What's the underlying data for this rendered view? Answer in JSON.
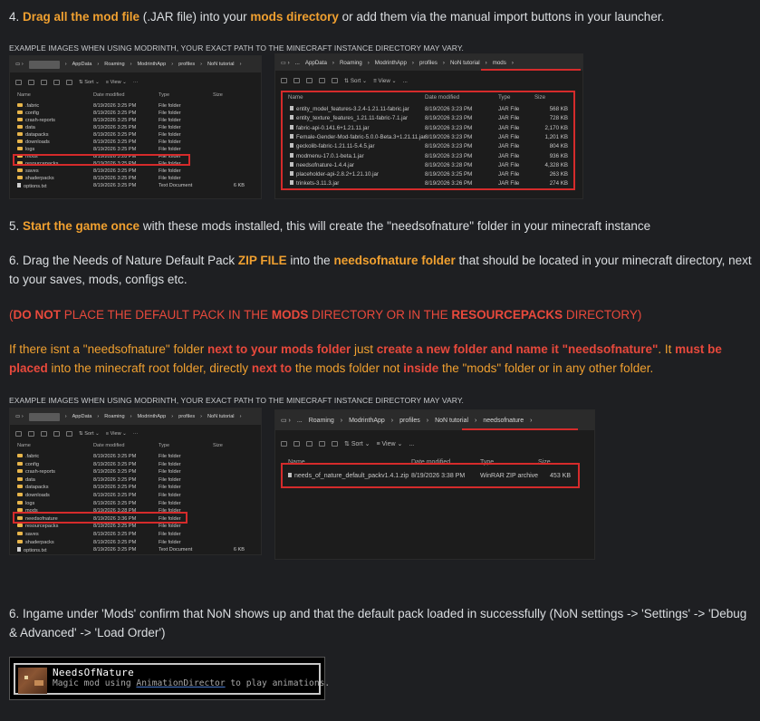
{
  "step4": {
    "prefix": "4. ",
    "b1": "Drag all the mod file",
    "t1": " (.JAR file) into your ",
    "b2": "mods directory",
    "t2": " or add them via the manual import buttons in your launcher."
  },
  "caption": "EXAMPLE IMAGES WHEN USING MODRINTH, YOUR EXACT PATH TO THE MINECRAFT INSTANCE DIRECTORY MAY VARY.",
  "ex1": {
    "path": [
      "AppData",
      "Roaming",
      "ModrinthApp",
      "profiles",
      "NoN tutorial"
    ],
    "tools": [
      "Sort",
      "View"
    ],
    "headers": [
      "Name",
      "Date modified",
      "Type",
      "Size"
    ],
    "rows": [
      {
        "name": ".fabric",
        "date": "8/19/2026 3:25 PM",
        "type": "File folder",
        "size": "",
        "kind": "folder"
      },
      {
        "name": "config",
        "date": "8/19/2026 3:25 PM",
        "type": "File folder",
        "size": "",
        "kind": "folder"
      },
      {
        "name": "crash-reports",
        "date": "8/19/2026 3:25 PM",
        "type": "File folder",
        "size": "",
        "kind": "folder"
      },
      {
        "name": "data",
        "date": "8/19/2026 3:25 PM",
        "type": "File folder",
        "size": "",
        "kind": "folder"
      },
      {
        "name": "datapacks",
        "date": "8/19/2026 3:25 PM",
        "type": "File folder",
        "size": "",
        "kind": "folder"
      },
      {
        "name": "downloads",
        "date": "8/19/2026 3:25 PM",
        "type": "File folder",
        "size": "",
        "kind": "folder"
      },
      {
        "name": "logs",
        "date": "8/19/2026 3:25 PM",
        "type": "File folder",
        "size": "",
        "kind": "folder"
      },
      {
        "name": "mods",
        "date": "8/19/2026 3:28 PM",
        "type": "File folder",
        "size": "",
        "kind": "folder"
      },
      {
        "name": "resourcepacks",
        "date": "8/19/2026 3:25 PM",
        "type": "File folder",
        "size": "",
        "kind": "folder"
      },
      {
        "name": "saves",
        "date": "8/19/2026 3:25 PM",
        "type": "File folder",
        "size": "",
        "kind": "folder"
      },
      {
        "name": "shaderpacks",
        "date": "8/19/2026 3:25 PM",
        "type": "File folder",
        "size": "",
        "kind": "folder"
      },
      {
        "name": "options.txt",
        "date": "8/19/2026 3:25 PM",
        "type": "Text Document",
        "size": "6 KB",
        "kind": "file"
      }
    ]
  },
  "ex2": {
    "path": [
      "...",
      "AppData",
      "Roaming",
      "ModrinthApp",
      "profiles",
      "NoN tutorial",
      "mods"
    ],
    "tools": [
      "Sort",
      "View",
      "..."
    ],
    "headers": [
      "Name",
      "Date modified",
      "Type",
      "Size"
    ],
    "rows": [
      {
        "name": "entity_model_features-3.2.4-1.21.11-fabric.jar",
        "date": "8/19/2026 3:23 PM",
        "type": "JAR File",
        "size": "568 KB"
      },
      {
        "name": "entity_texture_features_1.21.11-fabric-7.1.jar",
        "date": "8/19/2026 3:23 PM",
        "type": "JAR File",
        "size": "728 KB"
      },
      {
        "name": "fabric-api-0.141.6+1.21.11.jar",
        "date": "8/19/2026 3:23 PM",
        "type": "JAR File",
        "size": "2,170 KB"
      },
      {
        "name": "Female-Gender-Mod-fabric-5.0.0-Beta.3+1.21.11.jar",
        "date": "8/19/2026 3:23 PM",
        "type": "JAR File",
        "size": "1,201 KB"
      },
      {
        "name": "geckolib-fabric-1.21.11-5.4.5.jar",
        "date": "8/19/2026 3:23 PM",
        "type": "JAR File",
        "size": "804 KB"
      },
      {
        "name": "modmenu-17.0.1-beta.1.jar",
        "date": "8/19/2026 3:23 PM",
        "type": "JAR File",
        "size": "936 KB"
      },
      {
        "name": "needsofnature-1.4.4.jar",
        "date": "8/19/2026 3:28 PM",
        "type": "JAR File",
        "size": "4,328 KB"
      },
      {
        "name": "placeholder-api-2.8.2+1.21.10.jar",
        "date": "8/19/2026 3:25 PM",
        "type": "JAR File",
        "size": "263 KB"
      },
      {
        "name": "trinkets-3.11.3.jar",
        "date": "8/19/2026 3:26 PM",
        "type": "JAR File",
        "size": "274 KB"
      }
    ]
  },
  "step5": {
    "prefix": "5. ",
    "b1": "Start the game once",
    "t1": " with these mods installed, this will create the \"needsofnature\" folder in your minecraft instance"
  },
  "step6a": {
    "t1": "6. Drag the Needs of Nature Default Pack ",
    "b1": "ZIP FILE",
    "t2": " into the ",
    "b2": "needsofnature folder",
    "t3": " that should be located in your minecraft directory, next to your saves, mods, configs etc."
  },
  "warn": {
    "open": "(",
    "b1": "DO NOT",
    "t1": " PLACE THE DEFAULT PACK IN THE ",
    "b2": "MODS",
    "t2": " DIRECTORY OR IN THE ",
    "b3": "RESOURCEPACKS",
    "t3": " DIRECTORY)"
  },
  "note": {
    "t1": "If there isnt a \"needsofnature\" folder ",
    "b1": "next to your mods folder",
    "t2": " just ",
    "b2": "create a new folder and name it \"needsofnature\"",
    "t3": ". It ",
    "b3": "must be placed",
    "t4": " into the minecraft root folder, directly ",
    "b4": "next to",
    "t5": " the mods folder not ",
    "b5": "inside",
    "t6": " the \"mods\" folder or in any other folder."
  },
  "ex3": {
    "path": [
      "AppData",
      "Roaming",
      "ModrinthApp",
      "profiles",
      "NoN tutorial"
    ],
    "tools": [
      "Sort",
      "View"
    ],
    "headers": [
      "Name",
      "Date modified",
      "Type",
      "Size"
    ],
    "rows": [
      {
        "name": ".fabric",
        "date": "8/19/2026 3:25 PM",
        "type": "File folder",
        "size": "",
        "kind": "folder"
      },
      {
        "name": "config",
        "date": "8/19/2026 3:25 PM",
        "type": "File folder",
        "size": "",
        "kind": "folder"
      },
      {
        "name": "crash-reports",
        "date": "8/19/2026 3:25 PM",
        "type": "File folder",
        "size": "",
        "kind": "folder"
      },
      {
        "name": "data",
        "date": "8/19/2026 3:25 PM",
        "type": "File folder",
        "size": "",
        "kind": "folder"
      },
      {
        "name": "datapacks",
        "date": "8/19/2026 3:25 PM",
        "type": "File folder",
        "size": "",
        "kind": "folder"
      },
      {
        "name": "downloads",
        "date": "8/19/2026 3:25 PM",
        "type": "File folder",
        "size": "",
        "kind": "folder"
      },
      {
        "name": "logs",
        "date": "8/19/2026 3:25 PM",
        "type": "File folder",
        "size": "",
        "kind": "folder"
      },
      {
        "name": "mods",
        "date": "8/19/2026 3:28 PM",
        "type": "File folder",
        "size": "",
        "kind": "folder"
      },
      {
        "name": "needsofnature",
        "date": "8/19/2026 3:36 PM",
        "type": "File folder",
        "size": "",
        "kind": "folder"
      },
      {
        "name": "resourcepacks",
        "date": "8/19/2026 3:25 PM",
        "type": "File folder",
        "size": "",
        "kind": "folder"
      },
      {
        "name": "saves",
        "date": "8/19/2026 3:25 PM",
        "type": "File folder",
        "size": "",
        "kind": "folder"
      },
      {
        "name": "shaderpacks",
        "date": "8/19/2026 3:25 PM",
        "type": "File folder",
        "size": "",
        "kind": "folder"
      },
      {
        "name": "options.txt",
        "date": "8/19/2026 3:25 PM",
        "type": "Text Document",
        "size": "6 KB",
        "kind": "file"
      }
    ]
  },
  "ex4": {
    "path": [
      "...",
      "Roaming",
      "ModrinthApp",
      "profiles",
      "NoN tutorial",
      "needsofnature"
    ],
    "tools": [
      "Sort",
      "View",
      "..."
    ],
    "headers": [
      "Name",
      "Date modified",
      "Type",
      "Size"
    ],
    "rows": [
      {
        "name": "needs_of_nature_default_packv1.4.1.zip",
        "date": "8/19/2026 3:38 PM",
        "type": "WinRAR ZIP archive",
        "size": "453 KB"
      }
    ]
  },
  "step6b": {
    "text": "6. Ingame under 'Mods' confirm that NoN shows up and that the default pack loaded in successfully (NoN settings -> 'Settings' -> 'Debug & Advanced' -> 'Load Order')"
  },
  "mc": {
    "name": "NeedsOfNature",
    "desc_pre": "Magic mod using ",
    "desc_link": "AnimationDirector",
    "desc_post": " to play animations."
  },
  "colors": {
    "accent": "#f0a030",
    "warning": "#e8493c",
    "highlight": "#d52b2b",
    "background": "#1e1f22"
  }
}
